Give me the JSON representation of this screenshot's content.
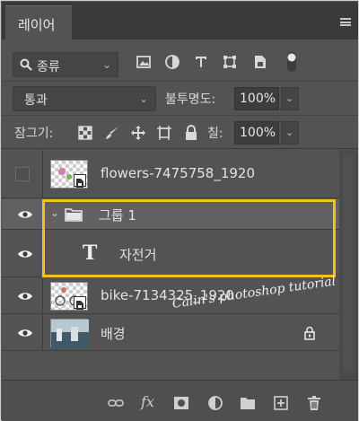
{
  "panel": {
    "tab_label": "레이어",
    "menu_icon": "panel-menu-icon"
  },
  "filter": {
    "kind_label": "종류",
    "icons": [
      "pixel-filter-icon",
      "adjustment-filter-icon",
      "type-filter-icon",
      "shape-filter-icon",
      "smart-object-filter-icon",
      "filter-toggle-icon"
    ]
  },
  "blend": {
    "mode": "통과",
    "opacity_label": "불투명도:",
    "opacity_value": "100%"
  },
  "lock": {
    "label": "잠그기:",
    "icons": [
      "lock-transparent-icon",
      "lock-image-icon",
      "lock-position-icon",
      "lock-artboard-icon",
      "lock-all-icon"
    ],
    "fill_label": "칠:",
    "fill_value": "100%"
  },
  "layers": [
    {
      "name": "flowers-7475758_1920",
      "visible": false,
      "type": "smart-object"
    },
    {
      "name": "그룹 1",
      "visible": true,
      "type": "group",
      "expanded": true
    },
    {
      "name": "자전거",
      "visible": true,
      "type": "text",
      "glyph": "T"
    },
    {
      "name": "bike-7134325_1920",
      "visible": true,
      "type": "smart-object"
    },
    {
      "name": "배경",
      "visible": true,
      "type": "background",
      "locked": true
    }
  ],
  "watermark": "Călin's photoshop tutorial",
  "bottom_icons": [
    "link-layers-icon",
    "fx-icon",
    "add-mask-icon",
    "adjustment-layer-icon",
    "new-group-icon",
    "new-layer-icon",
    "delete-layer-icon"
  ],
  "fx_label": "fx",
  "colors": {
    "panel_bg": "#535353",
    "highlight": "#f1c21b"
  }
}
